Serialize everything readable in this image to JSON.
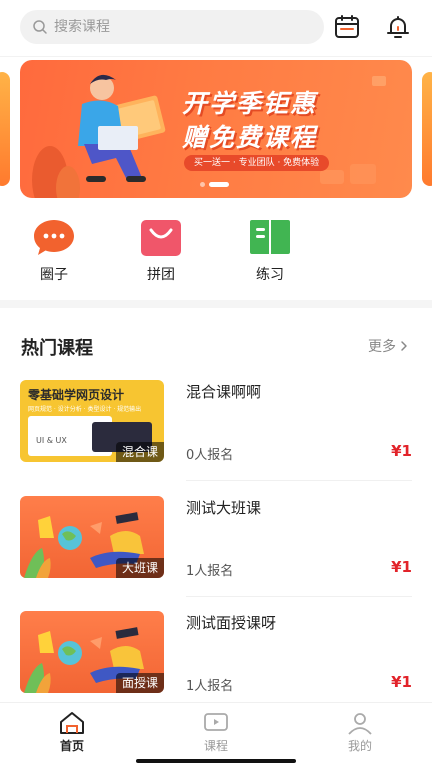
{
  "search": {
    "placeholder": "搜索课程"
  },
  "banner": {
    "title_line1": "开学季钜惠",
    "title_line2": "赠免费课程",
    "subtitle": "买一送一 · 专业团队 · 免费体验"
  },
  "quick_entries": [
    {
      "label": "圈子",
      "icon": "chat-bubble-icon",
      "color": "#f2622e"
    },
    {
      "label": "拼团",
      "icon": "shopping-bag-icon",
      "color": "#f0566a"
    },
    {
      "label": "练习",
      "icon": "book-icon",
      "color": "#41b552"
    }
  ],
  "hot_courses": {
    "title": "热门课程",
    "more": "更多",
    "items": [
      {
        "title": "混合课啊啊",
        "tag": "混合课",
        "enrolled": "0人报名",
        "price": "¥1",
        "thumb_heading": "零基础学网页设计",
        "thumb_sub": "网页规范 · 设计分析 · 类型设计 · 规范输出",
        "thumb_card": "UI & UX"
      },
      {
        "title": "测试大班课",
        "tag": "大班课",
        "enrolled": "1人报名",
        "price": "¥1"
      },
      {
        "title": "测试面授课呀",
        "tag": "面授课",
        "enrolled": "1人报名",
        "price": "¥1"
      }
    ]
  },
  "tabbar": [
    {
      "label": "首页",
      "icon": "home-icon",
      "active": true
    },
    {
      "label": "课程",
      "icon": "play-icon",
      "active": false
    },
    {
      "label": "我的",
      "icon": "user-icon",
      "active": false
    }
  ],
  "colors": {
    "accent": "#ff6a3d",
    "price": "#e2232a",
    "active_tab": "#222222",
    "inactive_tab": "#999999"
  }
}
